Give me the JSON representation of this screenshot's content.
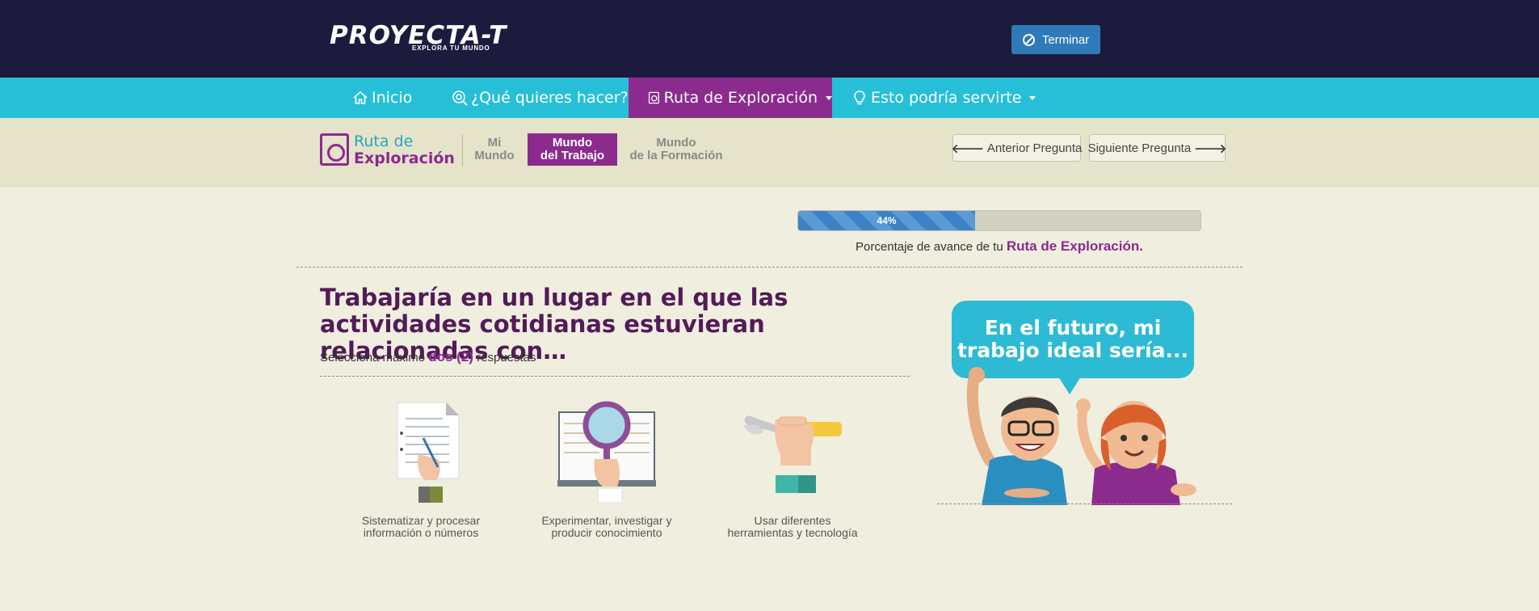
{
  "header": {
    "logo_main": "PROYECTA-T",
    "logo_sub": "EXPLORA TU MUNDO",
    "finish_label": "Terminar"
  },
  "nav": {
    "items": [
      {
        "label": "Inicio",
        "icon": "home-icon"
      },
      {
        "label": "¿Qué quieres hacer?",
        "icon": "search-target-icon"
      },
      {
        "label": "Ruta de Exploración",
        "icon": "route-icon",
        "active": true,
        "dropdown": true
      },
      {
        "label": "Esto podría servirte",
        "icon": "lightbulb-icon",
        "dropdown": true
      }
    ]
  },
  "subheader": {
    "brand_line1": "Ruta de",
    "brand_line2": "Exploración",
    "tabs": [
      {
        "line1": "Mi",
        "line2": "Mundo"
      },
      {
        "line1": "Mundo",
        "line2": "del Trabajo",
        "active": true
      },
      {
        "line1": "Mundo",
        "line2": "de la Formación"
      }
    ],
    "prev_label": "Anterior Pregunta",
    "next_label": "Siguiente Pregunta"
  },
  "progress": {
    "percent": 44,
    "label": "44%",
    "caption_prefix": "Porcentaje de avance de tu",
    "caption_bold": "Ruta de Exploración."
  },
  "question": {
    "title": "Trabajaría en un lugar en el que las actividades cotidianas estuvieran relacionadas con…",
    "instruction_prefix": "Selecciona máximo",
    "instruction_bold": "dos (2)",
    "instruction_suffix": "respuestas"
  },
  "options": [
    {
      "line1": "Sistematizar y procesar",
      "line2": "información o números",
      "icon": "document-writing-icon"
    },
    {
      "line1": "Experimentar, investigar y",
      "line2": "producir conocimiento",
      "icon": "magnifying-glass-book-icon"
    },
    {
      "line1": "Usar diferentes",
      "line2": "herramientas y tecnología",
      "icon": "wrench-tool-icon"
    }
  ],
  "illustration": {
    "bubble_line1": "En el futuro, mi",
    "bubble_line2": "trabajo ideal sería..."
  },
  "colors": {
    "header_bg": "#1d1b3d",
    "nav_bg": "#27bfd8",
    "accent_purple": "#8c2b8e",
    "button_blue": "#2f7ab8",
    "page_bg": "#f0eedf"
  }
}
